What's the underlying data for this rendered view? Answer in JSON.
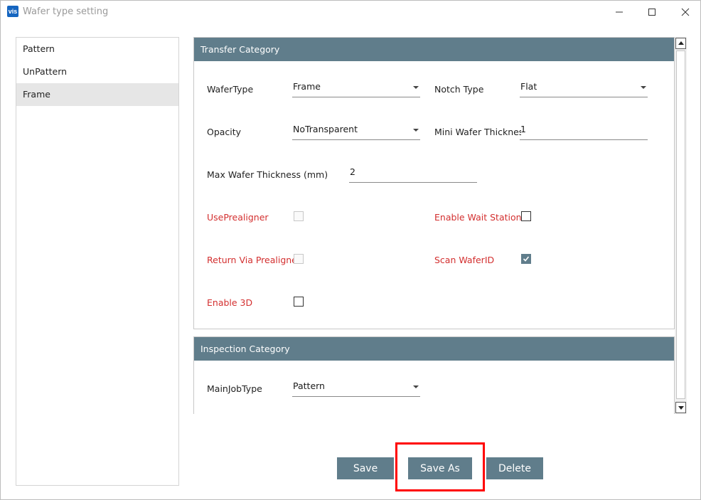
{
  "window": {
    "app_icon_text": "vis",
    "title": "Wafer type setting"
  },
  "list": {
    "items": [
      {
        "label": "Pattern",
        "selected": false
      },
      {
        "label": "UnPattern",
        "selected": false
      },
      {
        "label": "Frame",
        "selected": true
      }
    ]
  },
  "transfer": {
    "header": "Transfer Category",
    "wafer_type_label": "WaferType",
    "wafer_type_value": "Frame",
    "notch_type_label": "Notch Type",
    "notch_type_value": "Flat",
    "opacity_label": "Opacity",
    "opacity_value": "NoTransparent",
    "mini_thickness_label": "Mini Wafer Thickness",
    "mini_thickness_value": "1",
    "max_thickness_label": "Max Wafer Thickness (mm)",
    "max_thickness_value": "2",
    "use_prealigner_label": "UsePrealigner",
    "use_prealigner_checked": false,
    "enable_wait_station_label": "Enable Wait Station",
    "enable_wait_station_checked": false,
    "return_via_prealigner_label": "Return Via Prealigner",
    "return_via_prealigner_checked": false,
    "scan_waferid_label": "Scan WaferID",
    "scan_waferid_checked": true,
    "enable_3d_label": "Enable 3D",
    "enable_3d_checked": false
  },
  "inspection": {
    "header": "Inspection Category",
    "main_job_type_label": "MainJobType",
    "main_job_type_value": "Pattern"
  },
  "buttons": {
    "save": "Save",
    "save_as": "Save As",
    "delete": "Delete"
  },
  "colors": {
    "accent": "#607d8b",
    "required_label": "#d32f2f",
    "highlight": "#ff0000"
  }
}
